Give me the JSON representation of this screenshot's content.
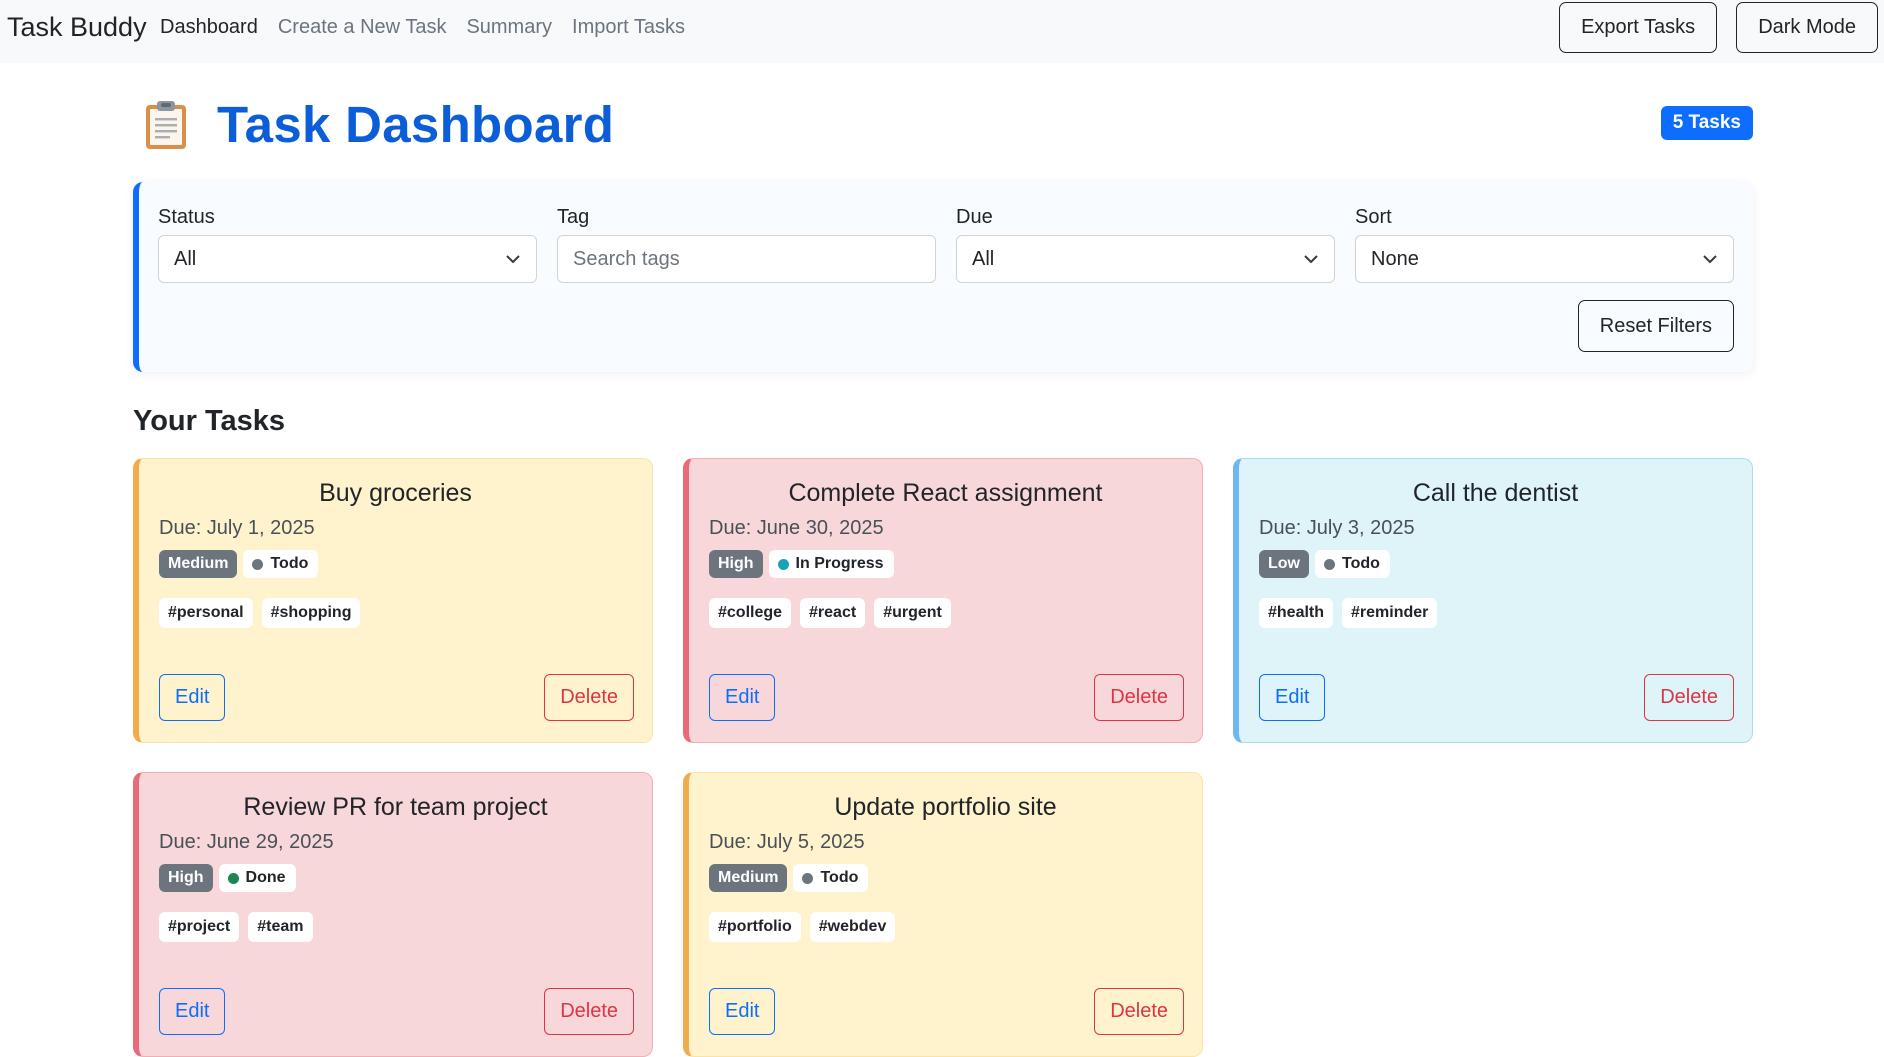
{
  "navbar": {
    "brand": "Task Buddy",
    "links": [
      "Dashboard",
      "Create a New Task",
      "Summary",
      "Import Tasks"
    ],
    "export_label": "Export Tasks",
    "darkmode_label": "Dark Mode"
  },
  "header": {
    "icon": "clipboard-icon",
    "title": "Task Dashboard",
    "count_label": "5 Tasks"
  },
  "filters": {
    "status": {
      "label": "Status",
      "value": "All"
    },
    "tag": {
      "label": "Tag",
      "placeholder": "Search tags"
    },
    "due": {
      "label": "Due",
      "value": "All"
    },
    "sort": {
      "label": "Sort",
      "value": "None"
    },
    "reset_label": "Reset Filters"
  },
  "section_title": "Your Tasks",
  "colors": {
    "brand_blue": "#0b5ed7",
    "medium_bg": "#fff3cd",
    "high_bg": "#f8d7da",
    "low_bg": "#dff4f8",
    "todo_dot": "#6c757d",
    "inprogress_dot": "#0dcaf0",
    "done_dot": "#198754"
  },
  "tasks": [
    {
      "title": "Buy groceries",
      "due": "Due: July 1, 2025",
      "priority": "Medium",
      "status": "Todo",
      "tags": [
        "#personal",
        "#shopping"
      ],
      "edit": "Edit",
      "delete": "Delete"
    },
    {
      "title": "Complete React assignment",
      "due": "Due: June 30, 2025",
      "priority": "High",
      "status": "In Progress",
      "tags": [
        "#college",
        "#react",
        "#urgent"
      ],
      "edit": "Edit",
      "delete": "Delete"
    },
    {
      "title": "Call the dentist",
      "due": "Due: July 3, 2025",
      "priority": "Low",
      "status": "Todo",
      "tags": [
        "#health",
        "#reminder"
      ],
      "edit": "Edit",
      "delete": "Delete"
    },
    {
      "title": "Review PR for team project",
      "due": "Due: June 29, 2025",
      "priority": "High",
      "status": "Done",
      "tags": [
        "#project",
        "#team"
      ],
      "edit": "Edit",
      "delete": "Delete"
    },
    {
      "title": "Update portfolio site",
      "due": "Due: July 5, 2025",
      "priority": "Medium",
      "status": "Todo",
      "tags": [
        "#portfolio",
        "#webdev"
      ],
      "edit": "Edit",
      "delete": "Delete"
    }
  ]
}
